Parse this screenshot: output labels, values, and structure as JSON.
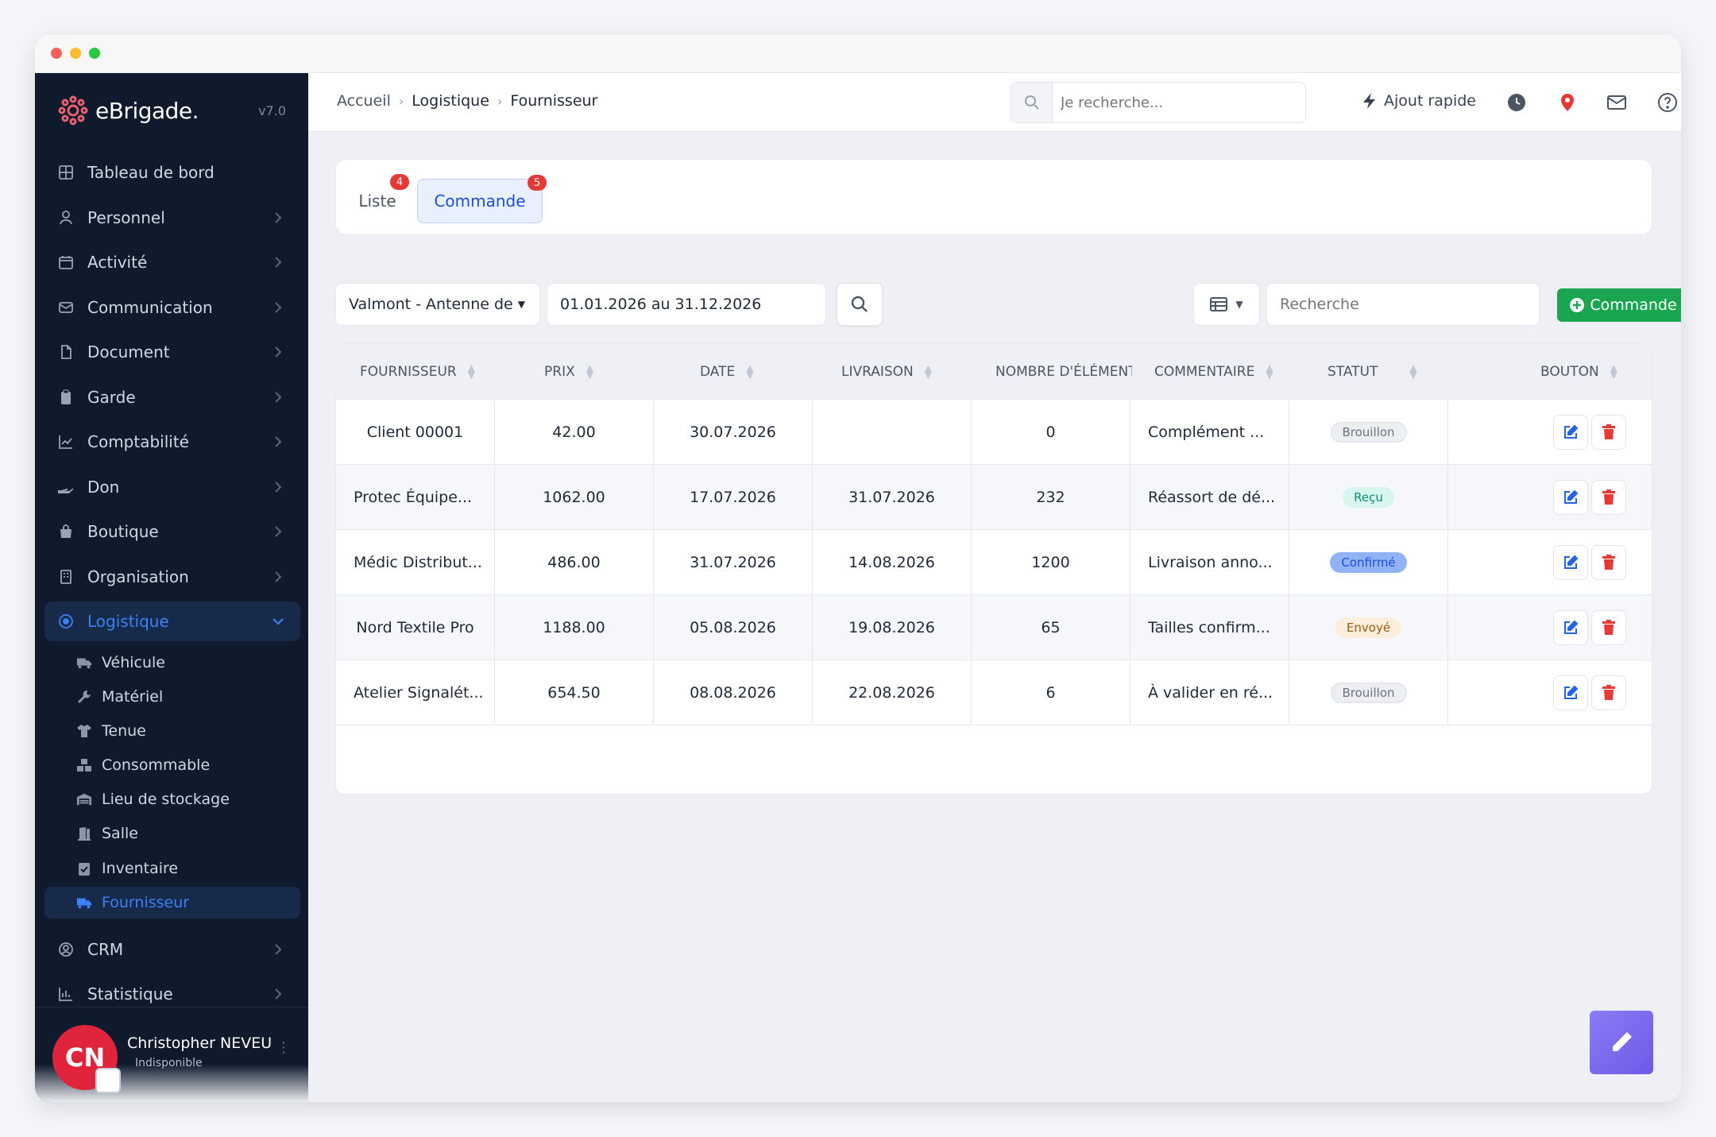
{
  "app": {
    "name": "eBrigade.",
    "version": "v7.0"
  },
  "sidebar": {
    "items": [
      {
        "label": "Tableau de bord",
        "icon": "grid-icon"
      },
      {
        "label": "Personnel",
        "icon": "user-icon"
      },
      {
        "label": "Activité",
        "icon": "calendar-icon"
      },
      {
        "label": "Communication",
        "icon": "mail-icon"
      },
      {
        "label": "Document",
        "icon": "file-icon"
      },
      {
        "label": "Garde",
        "icon": "clipboard-icon"
      },
      {
        "label": "Comptabilité",
        "icon": "chart-line-icon"
      },
      {
        "label": "Don",
        "icon": "hand-icon"
      },
      {
        "label": "Boutique",
        "icon": "bag-icon"
      },
      {
        "label": "Organisation",
        "icon": "building-icon"
      },
      {
        "label": "Logistique",
        "icon": "target-icon"
      }
    ],
    "sub_items": [
      {
        "label": "Véhicule",
        "icon": "truck-icon"
      },
      {
        "label": "Matériel",
        "icon": "wrench-icon"
      },
      {
        "label": "Tenue",
        "icon": "shirt-icon"
      },
      {
        "label": "Consommable",
        "icon": "boxes-icon"
      },
      {
        "label": "Lieu de stockage",
        "icon": "warehouse-icon"
      },
      {
        "label": "Salle",
        "icon": "door-icon"
      },
      {
        "label": "Inventaire",
        "icon": "clipboard-check-icon"
      },
      {
        "label": "Fournisseur",
        "icon": "truck-icon"
      }
    ],
    "items_bottom": [
      {
        "label": "CRM",
        "icon": "user-circle-icon"
      },
      {
        "label": "Statistique",
        "icon": "bar-chart-icon"
      }
    ]
  },
  "user": {
    "initials": "CN",
    "name": "Christopher NEVEU",
    "status": "Indisponible"
  },
  "breadcrumb": [
    "Accueil",
    "Logistique",
    "Fournisseur"
  ],
  "topbar": {
    "search_placeholder": "Je recherche...",
    "quick_add": "Ajout rapide"
  },
  "tabs": [
    {
      "label": "Liste",
      "badge": "4"
    },
    {
      "label": "Commande",
      "badge": "5"
    }
  ],
  "filters": {
    "section": "Valmont - Antenne de",
    "date_range": "01.01.2026 au 31.12.2026",
    "search_placeholder": "Recherche",
    "new_button": "Commande"
  },
  "table": {
    "columns": [
      "FOURNISSEUR",
      "PRIX",
      "DATE",
      "LIVRAISON",
      "NOMBRE D'ÉLÉMENTS",
      "COMMENTAIRE",
      "STATUT",
      "BOUTON"
    ],
    "rows": [
      {
        "fournisseur": "Client 00001",
        "prix": "42.00",
        "date": "30.07.2026",
        "livraison": "",
        "nombre": "0",
        "commentaire": "Complément ...",
        "statut": "Brouillon"
      },
      {
        "fournisseur": "Protec Équipe...",
        "prix": "1062.00",
        "date": "17.07.2026",
        "livraison": "31.07.2026",
        "nombre": "232",
        "commentaire": "Réassort de dé...",
        "statut": "Reçu"
      },
      {
        "fournisseur": "Médic Distribut...",
        "prix": "486.00",
        "date": "31.07.2026",
        "livraison": "14.08.2026",
        "nombre": "1200",
        "commentaire": "Livraison anno...",
        "statut": "Confirmé"
      },
      {
        "fournisseur": "Nord Textile Pro",
        "prix": "1188.00",
        "date": "05.08.2026",
        "livraison": "19.08.2026",
        "nombre": "65",
        "commentaire": "Tailles confirm...",
        "statut": "Envoyé"
      },
      {
        "fournisseur": "Atelier Signalét...",
        "prix": "654.50",
        "date": "08.08.2026",
        "livraison": "22.08.2026",
        "nombre": "6",
        "commentaire": "À valider en ré...",
        "statut": "Brouillon"
      }
    ]
  },
  "colors": {
    "accent": "#3b82f6",
    "sidebar_bg": "#0f1b2d",
    "green": "#1aa650",
    "danger": "#e53935"
  }
}
